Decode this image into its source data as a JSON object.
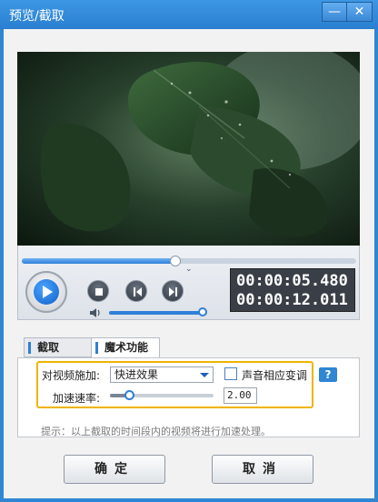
{
  "window": {
    "title": "预览/截取",
    "minimize_icon": "minimize-icon",
    "close_icon": "close-icon",
    "minimize_glyph": "—",
    "close_glyph": "✕"
  },
  "player": {
    "progress": 0.46,
    "volume": 0.95,
    "current_time": "00:00:05.480",
    "total_time": "00:00:12.011",
    "icons": [
      "play-icon",
      "stop-icon",
      "prev-frame-icon",
      "next-frame-icon",
      "volume-icon",
      "chevron-down-icon"
    ],
    "chevron_glyph": "⌄"
  },
  "tabs": [
    {
      "label": "截取",
      "active": false
    },
    {
      "label": "魔术功能",
      "active": true
    }
  ],
  "effects": {
    "apply_label": "对视频施加:",
    "effect_value": "快进效果",
    "sound_change_label": "声音相应变调",
    "sound_change_checked": false,
    "help_label": "?",
    "rate_label": "加速速率:",
    "rate_value": "2.00",
    "rate_slider": 0.18,
    "hint": "提示：以上截取的时间段内的视频将进行加速处理。"
  },
  "buttons": {
    "ok": "确定",
    "cancel": "取消"
  },
  "colors": {
    "accent": "#2f86d2",
    "highlight": "#f0b400"
  }
}
